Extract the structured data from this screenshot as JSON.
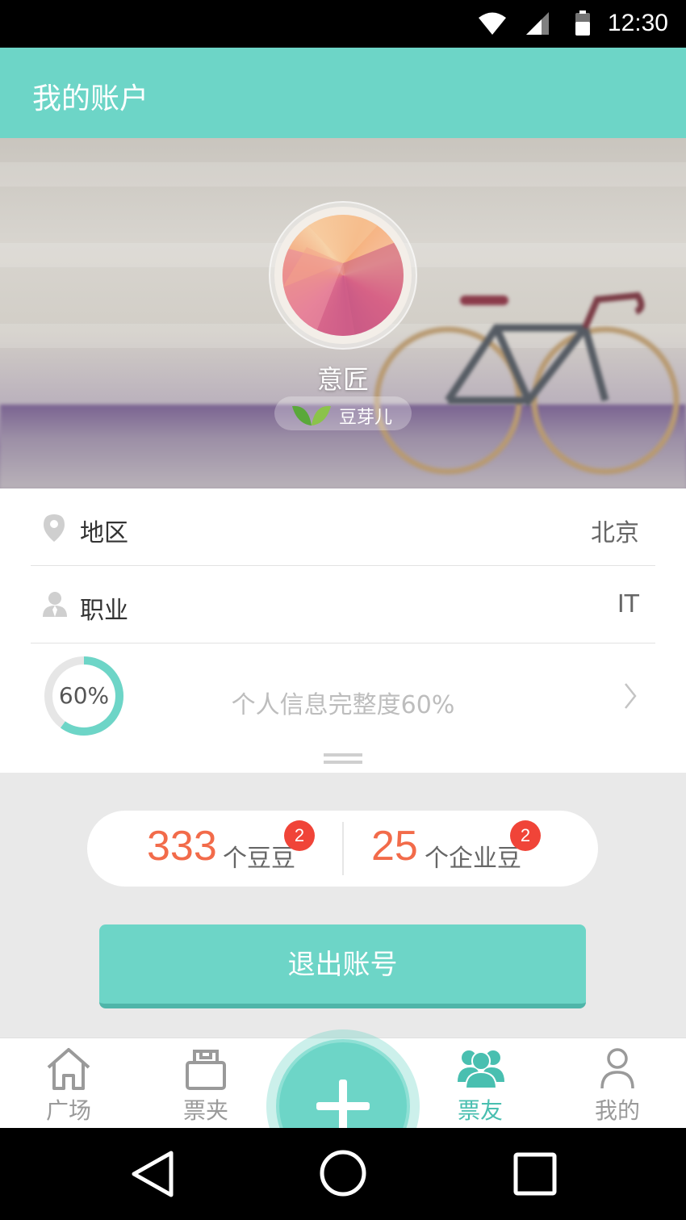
{
  "status_bar": {
    "time": "12:30",
    "icons": [
      "wifi-icon",
      "signal-icon",
      "battery-icon"
    ]
  },
  "header": {
    "title": "我的账户"
  },
  "profile": {
    "name": "意匠",
    "level": "豆芽儿"
  },
  "info": {
    "region_label": "地区",
    "region_value": "北京",
    "job_label": "职业",
    "job_value": "IT",
    "completion_percent_text": "60%",
    "completion_fraction": 0.6,
    "completion_text": "个人信息完整度60%"
  },
  "beans": {
    "personal": {
      "count": "333",
      "unit": "个豆豆",
      "badge": "2"
    },
    "enterprise": {
      "count": "25",
      "unit": "个企业豆",
      "badge": "2"
    }
  },
  "logout_label": "退出账号",
  "tabs": [
    {
      "label": "广场",
      "icon": "home-icon",
      "active": false
    },
    {
      "label": "票夹",
      "icon": "ticket-folder-icon",
      "active": false
    },
    {
      "label": "票友",
      "icon": "friends-icon",
      "active": true
    },
    {
      "label": "我的",
      "icon": "person-icon",
      "active": false
    }
  ],
  "colors": {
    "accent": "#6dd5c7",
    "accent_dark": "#49bfb0",
    "bean_number": "#f26b4a",
    "badge": "#f04438"
  }
}
